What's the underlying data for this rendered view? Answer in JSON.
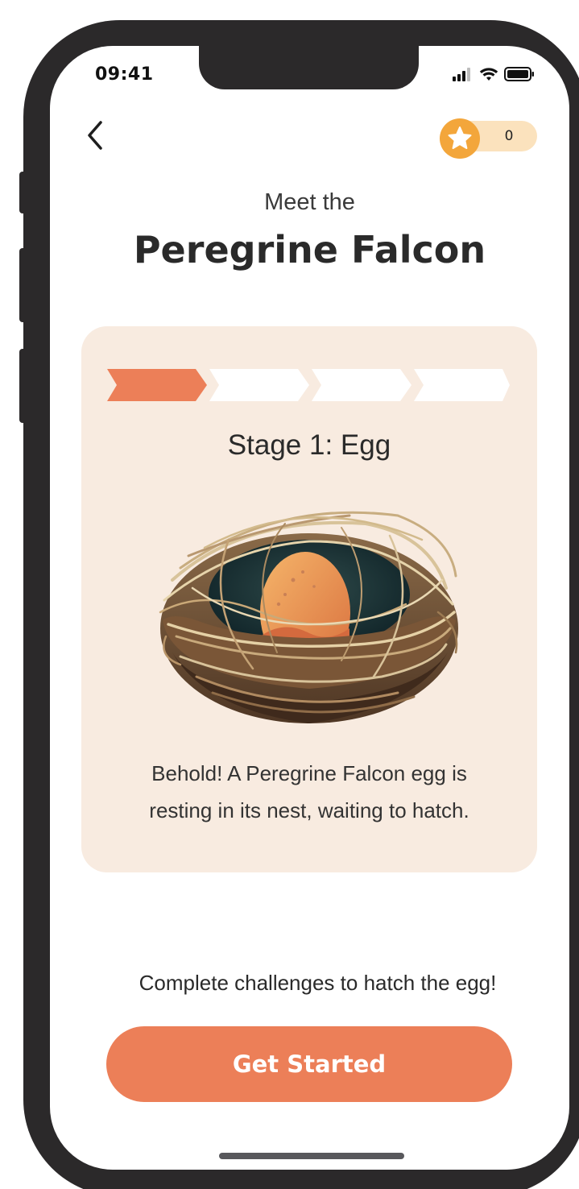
{
  "status_bar": {
    "time": "09:41",
    "icons": [
      "signal-icon",
      "wifi-icon",
      "battery-icon"
    ]
  },
  "header": {
    "back_icon": "chevron-left-icon",
    "star_icon": "star-icon",
    "star_count": "0"
  },
  "intro": {
    "subtitle": "Meet the",
    "title": "Peregrine Falcon"
  },
  "card": {
    "progress": {
      "total_stages": 4,
      "current_stage": 1
    },
    "stage_title": "Stage 1: Egg",
    "image": "egg-in-nest",
    "description_line1": "Behold! A Peregrine Falcon egg is",
    "description_line2": "resting in its nest, waiting to hatch."
  },
  "footer": {
    "hint": "Complete challenges to hatch the egg!",
    "cta_label": "Get Started"
  },
  "colors": {
    "accent": "#ec7f58",
    "card_bg": "#f8ebe0",
    "star": "#f3a63b",
    "star_pill": "#fbe2bd",
    "frame": "#2b292a"
  }
}
